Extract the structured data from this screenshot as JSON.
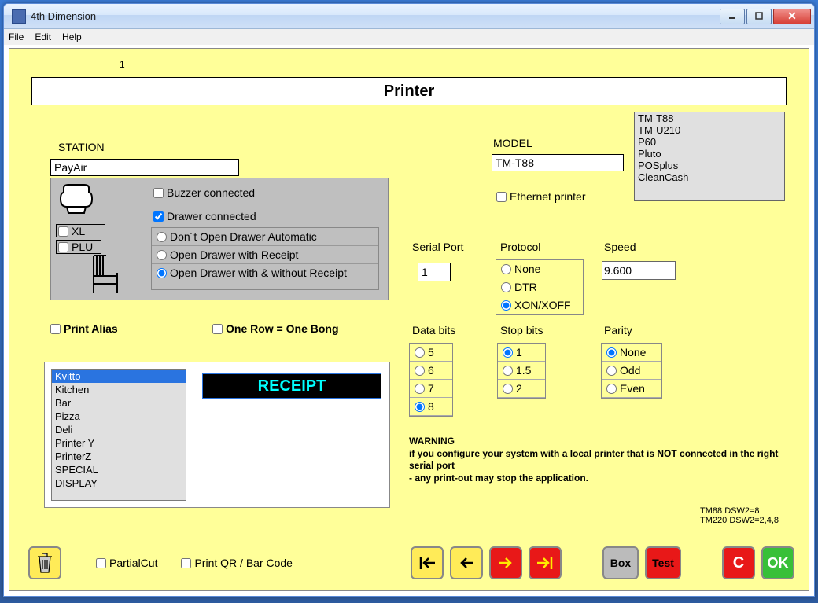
{
  "window": {
    "title": "4th Dimension"
  },
  "menu": {
    "file": "File",
    "edit": "Edit",
    "help": "Help"
  },
  "topnum": "1",
  "page_title": "Printer",
  "station": {
    "label": "STATION",
    "value": "PayAir"
  },
  "buzzer": {
    "label": "Buzzer connected",
    "checked": false
  },
  "drawer": {
    "label": "Drawer connected",
    "checked": true
  },
  "xl": {
    "label": "XL",
    "checked": false
  },
  "plu": {
    "label": "PLU",
    "checked": false
  },
  "drawer_opts": {
    "a": "Don´t Open Drawer Automatic",
    "b": "Open Drawer with Receipt",
    "c": "Open Drawer with & without Receipt",
    "selected": "c"
  },
  "print_alias": {
    "label": "Print Alias",
    "checked": false
  },
  "one_row": {
    "label": "One Row = One Bong",
    "checked": false
  },
  "printer_list": [
    "Kvitto",
    "Kitchen",
    "Bar",
    "Pizza",
    "Deli",
    "Printer Y",
    "PrinterZ",
    "SPECIAL",
    "DISPLAY"
  ],
  "printer_selected": "Kvitto",
  "receipt_band": "RECEIPT",
  "model": {
    "label": "MODEL",
    "value": "TM-T88"
  },
  "ethernet": {
    "label": "Ethernet printer",
    "checked": false
  },
  "model_list": [
    "TM-T88",
    "TM-U210",
    "P60",
    "Pluto",
    "POSplus",
    "CleanCash"
  ],
  "serial": {
    "label": "Serial Port",
    "value": "1"
  },
  "protocol": {
    "label": "Protocol",
    "a": "None",
    "b": "DTR",
    "c": "XON/XOFF",
    "selected": "c"
  },
  "speed": {
    "label": "Speed",
    "value": "9.600"
  },
  "databits": {
    "label": "Data bits",
    "opts": [
      "5",
      "6",
      "7",
      "8"
    ],
    "selected": "8"
  },
  "stopbits": {
    "label": "Stop bits",
    "opts": [
      "1",
      "1.5",
      "2"
    ],
    "selected": "1"
  },
  "parity": {
    "label": "Parity",
    "opts": [
      "None",
      "Odd",
      "Even"
    ],
    "selected": "None"
  },
  "warning_title": "WARNING",
  "warning_l1": "if you configure your system with a local printer that is NOT connected in the right serial port",
  "warning_l2": " - any print-out may stop the application.",
  "dsw": {
    "a": "TM88  DSW2=8",
    "b": "TM220 DSW2=2,4,8"
  },
  "bottom": {
    "partial": "PartialCut",
    "qr": "Print QR / Bar Code",
    "box": "Box",
    "test": "Test",
    "c": "C",
    "ok": "OK"
  }
}
